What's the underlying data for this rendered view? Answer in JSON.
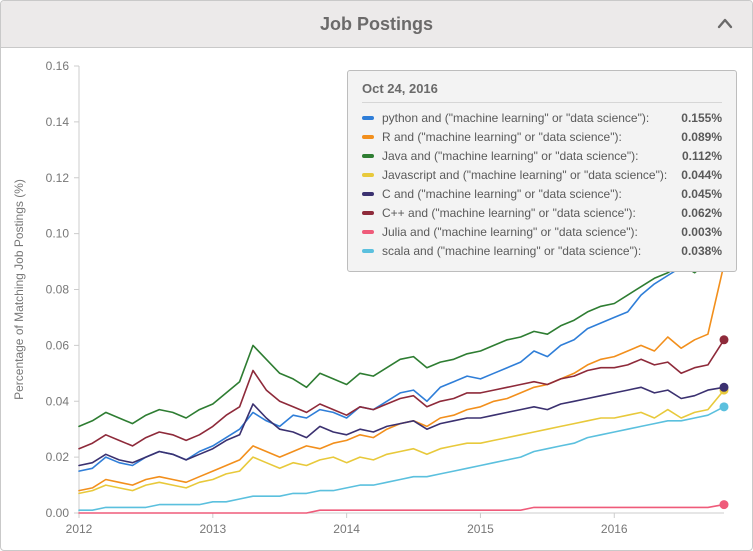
{
  "header": {
    "title": "Job Postings"
  },
  "tooltip": {
    "date": "Oct 24, 2016"
  },
  "chart_data": {
    "type": "line",
    "title": "Job Postings",
    "xlabel": "",
    "ylabel": "Percentage of Matching Job Postings (%)",
    "xlim": [
      2012,
      2016.82
    ],
    "ylim": [
      0.0,
      0.16
    ],
    "x_ticks": [
      2012,
      2013,
      2014,
      2015,
      2016
    ],
    "y_ticks": [
      0.0,
      0.02,
      0.04,
      0.06,
      0.08,
      0.1,
      0.12,
      0.14,
      0.16
    ],
    "x": [
      2012.0,
      2012.1,
      2012.2,
      2012.3,
      2012.4,
      2012.5,
      2012.6,
      2012.7,
      2012.8,
      2012.9,
      2013.0,
      2013.1,
      2013.2,
      2013.3,
      2013.4,
      2013.5,
      2013.6,
      2013.7,
      2013.8,
      2013.9,
      2014.0,
      2014.1,
      2014.2,
      2014.3,
      2014.4,
      2014.5,
      2014.6,
      2014.7,
      2014.8,
      2014.9,
      2015.0,
      2015.1,
      2015.2,
      2015.3,
      2015.4,
      2015.5,
      2015.6,
      2015.7,
      2015.8,
      2015.9,
      2016.0,
      2016.1,
      2016.2,
      2016.3,
      2016.4,
      2016.5,
      2016.6,
      2016.7,
      2016.82
    ],
    "series": [
      {
        "name": "python and (\"machine learning\" or \"data science\")",
        "color": "#2f7ed8",
        "end_value": "0.155%",
        "values": [
          0.015,
          0.016,
          0.02,
          0.018,
          0.017,
          0.02,
          0.022,
          0.021,
          0.019,
          0.022,
          0.024,
          0.027,
          0.03,
          0.036,
          0.033,
          0.031,
          0.035,
          0.034,
          0.037,
          0.036,
          0.034,
          0.038,
          0.037,
          0.04,
          0.043,
          0.044,
          0.04,
          0.045,
          0.047,
          0.049,
          0.048,
          0.05,
          0.052,
          0.054,
          0.058,
          0.056,
          0.06,
          0.062,
          0.066,
          0.068,
          0.07,
          0.072,
          0.078,
          0.082,
          0.085,
          0.088,
          0.088,
          0.095,
          0.155
        ]
      },
      {
        "name": "R and (\"machine learning\" or \"data science\")",
        "color": "#f28f1c",
        "end_value": "0.089%",
        "values": [
          0.008,
          0.009,
          0.012,
          0.011,
          0.01,
          0.012,
          0.013,
          0.012,
          0.011,
          0.013,
          0.015,
          0.017,
          0.019,
          0.024,
          0.022,
          0.02,
          0.022,
          0.024,
          0.023,
          0.025,
          0.026,
          0.028,
          0.027,
          0.03,
          0.032,
          0.033,
          0.031,
          0.034,
          0.035,
          0.037,
          0.038,
          0.04,
          0.041,
          0.043,
          0.045,
          0.046,
          0.048,
          0.05,
          0.053,
          0.055,
          0.056,
          0.058,
          0.06,
          0.058,
          0.063,
          0.059,
          0.062,
          0.064,
          0.089
        ]
      },
      {
        "name": "Java and (\"machine learning\" or \"data science\")",
        "color": "#2e7d32",
        "end_value": "0.112%",
        "values": [
          0.031,
          0.033,
          0.036,
          0.034,
          0.032,
          0.035,
          0.037,
          0.036,
          0.034,
          0.037,
          0.039,
          0.043,
          0.047,
          0.06,
          0.055,
          0.05,
          0.048,
          0.045,
          0.05,
          0.048,
          0.046,
          0.05,
          0.049,
          0.052,
          0.055,
          0.056,
          0.052,
          0.054,
          0.055,
          0.057,
          0.058,
          0.06,
          0.062,
          0.063,
          0.065,
          0.064,
          0.067,
          0.069,
          0.072,
          0.074,
          0.075,
          0.078,
          0.081,
          0.084,
          0.086,
          0.089,
          0.086,
          0.09,
          0.112
        ]
      },
      {
        "name": "Javascript and (\"machine learning\" or \"data science\")",
        "color": "#e8c93b",
        "end_value": "0.044%",
        "values": [
          0.007,
          0.008,
          0.01,
          0.009,
          0.008,
          0.01,
          0.011,
          0.01,
          0.009,
          0.011,
          0.012,
          0.014,
          0.015,
          0.02,
          0.018,
          0.016,
          0.018,
          0.017,
          0.019,
          0.02,
          0.018,
          0.02,
          0.019,
          0.021,
          0.022,
          0.023,
          0.021,
          0.023,
          0.024,
          0.025,
          0.025,
          0.026,
          0.027,
          0.028,
          0.029,
          0.03,
          0.031,
          0.032,
          0.033,
          0.034,
          0.034,
          0.035,
          0.036,
          0.034,
          0.037,
          0.034,
          0.036,
          0.037,
          0.044
        ]
      },
      {
        "name": "C and (\"machine learning\" or \"data science\")",
        "color": "#3b3170",
        "end_value": "0.045%",
        "values": [
          0.017,
          0.018,
          0.021,
          0.019,
          0.018,
          0.02,
          0.022,
          0.021,
          0.019,
          0.021,
          0.023,
          0.026,
          0.028,
          0.039,
          0.034,
          0.03,
          0.029,
          0.027,
          0.031,
          0.029,
          0.028,
          0.03,
          0.029,
          0.031,
          0.032,
          0.033,
          0.03,
          0.032,
          0.033,
          0.034,
          0.034,
          0.035,
          0.036,
          0.037,
          0.038,
          0.037,
          0.039,
          0.04,
          0.041,
          0.042,
          0.043,
          0.044,
          0.045,
          0.043,
          0.044,
          0.041,
          0.042,
          0.044,
          0.045
        ]
      },
      {
        "name": "C++ and (\"machine learning\" or \"data science\")",
        "color": "#8e2a3a",
        "end_value": "0.062%",
        "values": [
          0.023,
          0.025,
          0.028,
          0.026,
          0.024,
          0.027,
          0.029,
          0.028,
          0.026,
          0.028,
          0.031,
          0.035,
          0.038,
          0.051,
          0.044,
          0.04,
          0.038,
          0.036,
          0.039,
          0.037,
          0.035,
          0.038,
          0.037,
          0.039,
          0.041,
          0.042,
          0.038,
          0.04,
          0.041,
          0.043,
          0.043,
          0.044,
          0.045,
          0.046,
          0.047,
          0.046,
          0.048,
          0.049,
          0.051,
          0.052,
          0.052,
          0.053,
          0.055,
          0.053,
          0.054,
          0.05,
          0.052,
          0.053,
          0.062
        ]
      },
      {
        "name": "Julia and (\"machine learning\" or \"data science\")",
        "color": "#ef5b7a",
        "end_value": "0.003%",
        "values": [
          0.0,
          0.0,
          0.0,
          0.0,
          0.0,
          0.0,
          0.0,
          0.0,
          0.0,
          0.0,
          0.0,
          0.0,
          0.0,
          0.0,
          0.0,
          0.0,
          0.0,
          0.0,
          0.001,
          0.001,
          0.001,
          0.001,
          0.001,
          0.001,
          0.001,
          0.001,
          0.001,
          0.001,
          0.001,
          0.001,
          0.001,
          0.001,
          0.001,
          0.001,
          0.002,
          0.002,
          0.002,
          0.002,
          0.002,
          0.002,
          0.002,
          0.002,
          0.002,
          0.002,
          0.002,
          0.002,
          0.002,
          0.002,
          0.003
        ]
      },
      {
        "name": "scala and (\"machine learning\" or \"data science\")",
        "color": "#5bc0de",
        "end_value": "0.038%",
        "values": [
          0.001,
          0.001,
          0.002,
          0.002,
          0.002,
          0.002,
          0.003,
          0.003,
          0.003,
          0.003,
          0.004,
          0.004,
          0.005,
          0.006,
          0.006,
          0.006,
          0.007,
          0.007,
          0.008,
          0.008,
          0.009,
          0.01,
          0.01,
          0.011,
          0.012,
          0.013,
          0.013,
          0.014,
          0.015,
          0.016,
          0.017,
          0.018,
          0.019,
          0.02,
          0.022,
          0.023,
          0.024,
          0.025,
          0.027,
          0.028,
          0.029,
          0.03,
          0.031,
          0.032,
          0.033,
          0.033,
          0.034,
          0.035,
          0.038
        ]
      }
    ]
  }
}
